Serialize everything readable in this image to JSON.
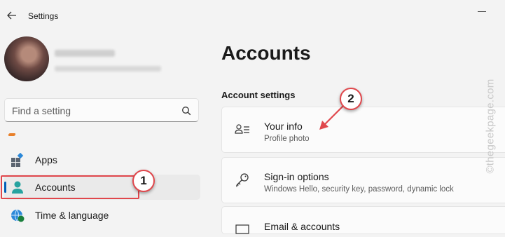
{
  "window": {
    "title": "Settings"
  },
  "search": {
    "placeholder": "Find a setting"
  },
  "nav": {
    "items": [
      {
        "label": "Apps",
        "icon": "apps-icon"
      },
      {
        "label": "Accounts",
        "icon": "accounts-icon",
        "selected": true
      },
      {
        "label": "Time & language",
        "icon": "globe-clock-icon"
      }
    ]
  },
  "main": {
    "title": "Accounts",
    "section": "Account settings",
    "cards": [
      {
        "title": "Your info",
        "subtitle": "Profile photo",
        "icon": "person-info-icon"
      },
      {
        "title": "Sign-in options",
        "subtitle": "Windows Hello, security key, password, dynamic lock",
        "icon": "key-icon"
      },
      {
        "title": "Email & accounts",
        "subtitle": "",
        "icon": "mail-icon"
      }
    ]
  },
  "annotations": {
    "badge1": "1",
    "badge2": "2",
    "color": "#e0474c"
  },
  "watermark": "©thegeekpage.com",
  "colors": {
    "accent": "#005fb8",
    "background": "#f3f3f3",
    "card": "#fbfbfb"
  }
}
